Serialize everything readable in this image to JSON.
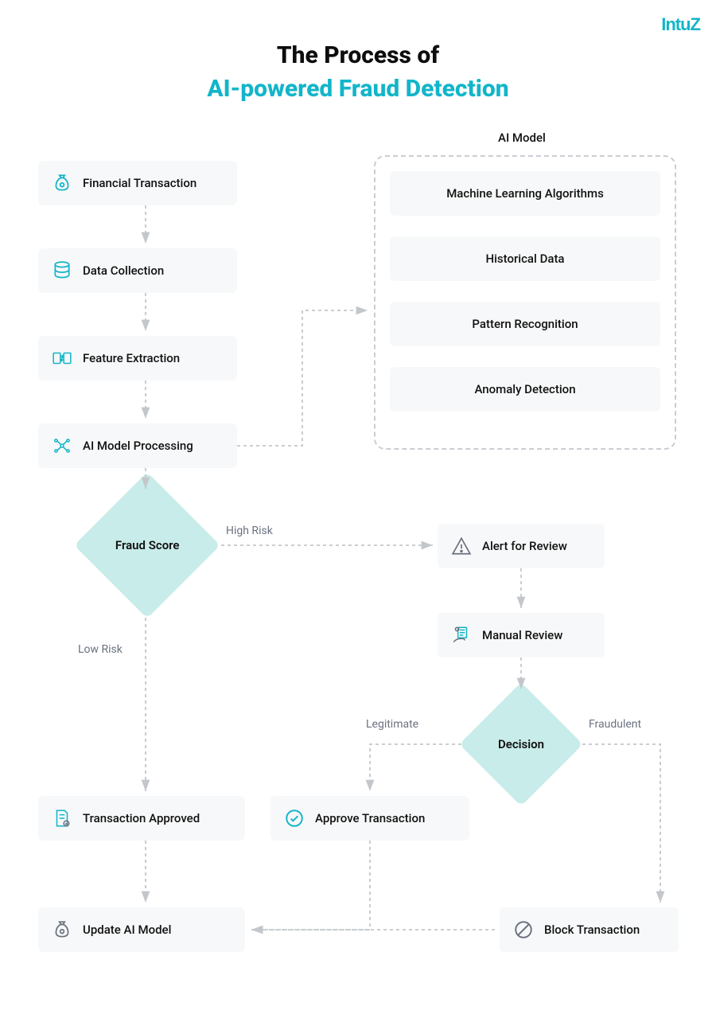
{
  "brand": "InTuZ",
  "title_line1": "The Process of",
  "title_line2": "AI-powered Fraud Detection",
  "ai_model_group_title": "AI Model",
  "nodes": {
    "financial_transaction": "Financial Transaction",
    "data_collection": "Data Collection",
    "feature_extraction": "Feature Extraction",
    "ai_model_processing": "AI Model Processing",
    "ml_algorithms": "Machine Learning Algorithms",
    "historical_data": "Historical Data",
    "pattern_recognition": "Pattern Recognition",
    "anomaly_detection": "Anomaly Detection",
    "fraud_score": "Fraud Score",
    "alert_for_review": "Alert for Review",
    "manual_review": "Manual Review",
    "decision": "Decision",
    "transaction_approved": "Transaction Approved",
    "approve_transaction": "Approve Transaction",
    "update_ai_model": "Update AI Model",
    "block_transaction": "Block Transaction"
  },
  "edge_labels": {
    "high_risk": "High Risk",
    "low_risk": "Low Risk",
    "legitimate": "Legitimate",
    "fraudulent": "Fraudulent"
  },
  "chart_data": {
    "type": "flowchart",
    "title": "The Process of AI-powered Fraud Detection",
    "nodes": [
      {
        "id": "financial_transaction",
        "label": "Financial Transaction",
        "kind": "process"
      },
      {
        "id": "data_collection",
        "label": "Data Collection",
        "kind": "process"
      },
      {
        "id": "feature_extraction",
        "label": "Feature Extraction",
        "kind": "process"
      },
      {
        "id": "ai_model_processing",
        "label": "AI Model Processing",
        "kind": "process"
      },
      {
        "id": "ai_model_group",
        "label": "AI Model",
        "kind": "group",
        "children": [
          "ml_algorithms",
          "historical_data",
          "pattern_recognition",
          "anomaly_detection"
        ]
      },
      {
        "id": "ml_algorithms",
        "label": "Machine Learning Algorithms",
        "kind": "component"
      },
      {
        "id": "historical_data",
        "label": "Historical Data",
        "kind": "component"
      },
      {
        "id": "pattern_recognition",
        "label": "Pattern Recognition",
        "kind": "component"
      },
      {
        "id": "anomaly_detection",
        "label": "Anomaly Detection",
        "kind": "component"
      },
      {
        "id": "fraud_score",
        "label": "Fraud Score",
        "kind": "decision"
      },
      {
        "id": "alert_for_review",
        "label": "Alert for Review",
        "kind": "process"
      },
      {
        "id": "manual_review",
        "label": "Manual Review",
        "kind": "process"
      },
      {
        "id": "decision",
        "label": "Decision",
        "kind": "decision"
      },
      {
        "id": "transaction_approved",
        "label": "Transaction Approved",
        "kind": "process"
      },
      {
        "id": "approve_transaction",
        "label": "Approve Transaction",
        "kind": "process"
      },
      {
        "id": "block_transaction",
        "label": "Block Transaction",
        "kind": "process"
      },
      {
        "id": "update_ai_model",
        "label": "Update AI Model",
        "kind": "process"
      }
    ],
    "edges": [
      {
        "from": "financial_transaction",
        "to": "data_collection"
      },
      {
        "from": "data_collection",
        "to": "feature_extraction"
      },
      {
        "from": "feature_extraction",
        "to": "ai_model_processing"
      },
      {
        "from": "ai_model_processing",
        "to": "ai_model_group"
      },
      {
        "from": "ai_model_processing",
        "to": "fraud_score"
      },
      {
        "from": "fraud_score",
        "to": "alert_for_review",
        "label": "High Risk"
      },
      {
        "from": "fraud_score",
        "to": "transaction_approved",
        "label": "Low Risk"
      },
      {
        "from": "alert_for_review",
        "to": "manual_review"
      },
      {
        "from": "manual_review",
        "to": "decision"
      },
      {
        "from": "decision",
        "to": "approve_transaction",
        "label": "Legitimate"
      },
      {
        "from": "decision",
        "to": "block_transaction",
        "label": "Fraudulent"
      },
      {
        "from": "transaction_approved",
        "to": "update_ai_model"
      },
      {
        "from": "approve_transaction",
        "to": "update_ai_model"
      },
      {
        "from": "block_transaction",
        "to": "update_ai_model"
      }
    ]
  }
}
